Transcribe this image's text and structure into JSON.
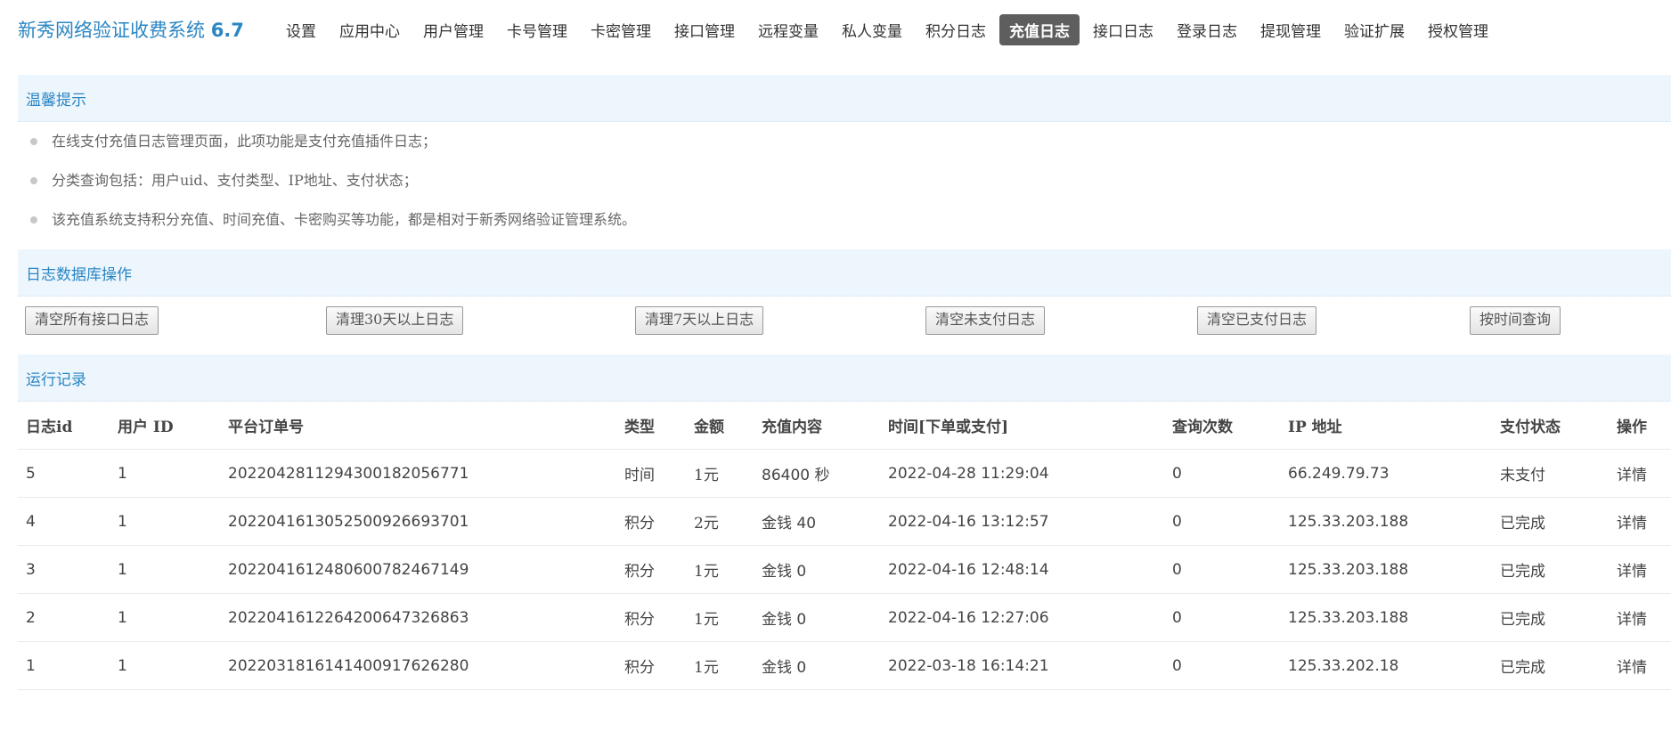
{
  "app": {
    "title": "新秀网络验证收费系统",
    "version": "6.7"
  },
  "nav": [
    {
      "label": "设置",
      "active": false
    },
    {
      "label": "应用中心",
      "active": false
    },
    {
      "label": "用户管理",
      "active": false
    },
    {
      "label": "卡号管理",
      "active": false
    },
    {
      "label": "卡密管理",
      "active": false
    },
    {
      "label": "接口管理",
      "active": false
    },
    {
      "label": "远程变量",
      "active": false
    },
    {
      "label": "私人变量",
      "active": false
    },
    {
      "label": "积分日志",
      "active": false
    },
    {
      "label": "充值日志",
      "active": true
    },
    {
      "label": "接口日志",
      "active": false
    },
    {
      "label": "登录日志",
      "active": false
    },
    {
      "label": "提现管理",
      "active": false
    },
    {
      "label": "验证扩展",
      "active": false
    },
    {
      "label": "授权管理",
      "active": false
    }
  ],
  "tips": {
    "title": "温馨提示",
    "items": [
      "在线支付充值日志管理页面，此项功能是支付充值插件日志；",
      "分类查询包括：用户uid、支付类型、IP地址、支付状态；",
      "该充值系统支持积分充值、时间充值、卡密购买等功能，都是相对于新秀网络验证管理系统。"
    ]
  },
  "db_ops": {
    "title": "日志数据库操作",
    "buttons": [
      "清空所有接口日志",
      "清理30天以上日志",
      "清理7天以上日志",
      "清空未支付日志",
      "清空已支付日志",
      "按时间查询"
    ]
  },
  "records": {
    "title": "运行记录",
    "columns": [
      "日志id",
      "用户 ID",
      "平台订单号",
      "类型",
      "金额",
      "充值内容",
      "时间[下单或支付]",
      "查询次数",
      "IP 地址",
      "支付状态",
      "操作"
    ],
    "rows": [
      {
        "id": "5",
        "uid": "1",
        "order": "20220428112943001820567 71",
        "type": "时间",
        "amount": "1元",
        "content": "86400 秒",
        "time": "2022-04-28 11:29:04",
        "queries": "0",
        "ip": "66.249.79.73",
        "status": "未支付",
        "action": "详情"
      },
      {
        "id": "4",
        "uid": "1",
        "order": "20220416130525009266937 01",
        "type": "积分",
        "amount": "2元",
        "content": "金钱 40",
        "time": "2022-04-16 13:12:57",
        "queries": "0",
        "ip": "125.33.203.188",
        "status": "已完成",
        "action": "详情"
      },
      {
        "id": "3",
        "uid": "1",
        "order": "20220416124806007824671 49",
        "type": "积分",
        "amount": "1元",
        "content": "金钱 0",
        "time": "2022-04-16 12:48:14",
        "queries": "0",
        "ip": "125.33.203.188",
        "status": "已完成",
        "action": "详情"
      },
      {
        "id": "2",
        "uid": "1",
        "order": "20220416122642006473268 63",
        "type": "积分",
        "amount": "1元",
        "content": "金钱 0",
        "time": "2022-04-16 12:27:06",
        "queries": "0",
        "ip": "125.33.203.188",
        "status": "已完成",
        "action": "详情"
      },
      {
        "id": "1",
        "uid": "1",
        "order": "20220318161414009176262 80",
        "type": "积分",
        "amount": "1元",
        "content": "金钱 0",
        "time": "2022-03-18 16:14:21",
        "queries": "0",
        "ip": "125.33.202.18",
        "status": "已完成",
        "action": "详情"
      }
    ]
  },
  "colors": {
    "brand": "#2a86c4",
    "section_bg": "#eef6fd",
    "active_nav_bg": "#5e5e5e",
    "red": "#e01010",
    "green": "#1d7a1d",
    "link_blue": "#2a5fa0"
  }
}
